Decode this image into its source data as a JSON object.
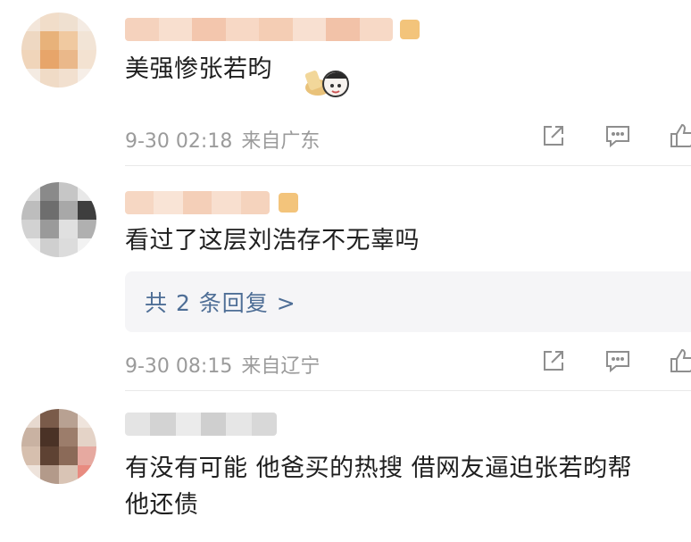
{
  "comments": [
    {
      "text": "美强惨张若昀",
      "time": "9-30 02:18",
      "location": "来自广东"
    },
    {
      "text": "看过了这层刘浩存不无辜吗",
      "time": "9-30 08:15",
      "location": "来自辽宁",
      "replies_label": "共 2 条回复 >"
    },
    {
      "text_line1": "有没有可能 他爸买的热搜  借网友逼迫张若昀帮",
      "text_line2": "他还债"
    }
  ],
  "icons": [
    "share-icon",
    "comment-icon",
    "like-icon"
  ],
  "colors": {
    "text": "#1f1f1f",
    "meta": "#9b9b9b",
    "link": "#4e6e96",
    "reply_bg": "#f5f5f7"
  }
}
